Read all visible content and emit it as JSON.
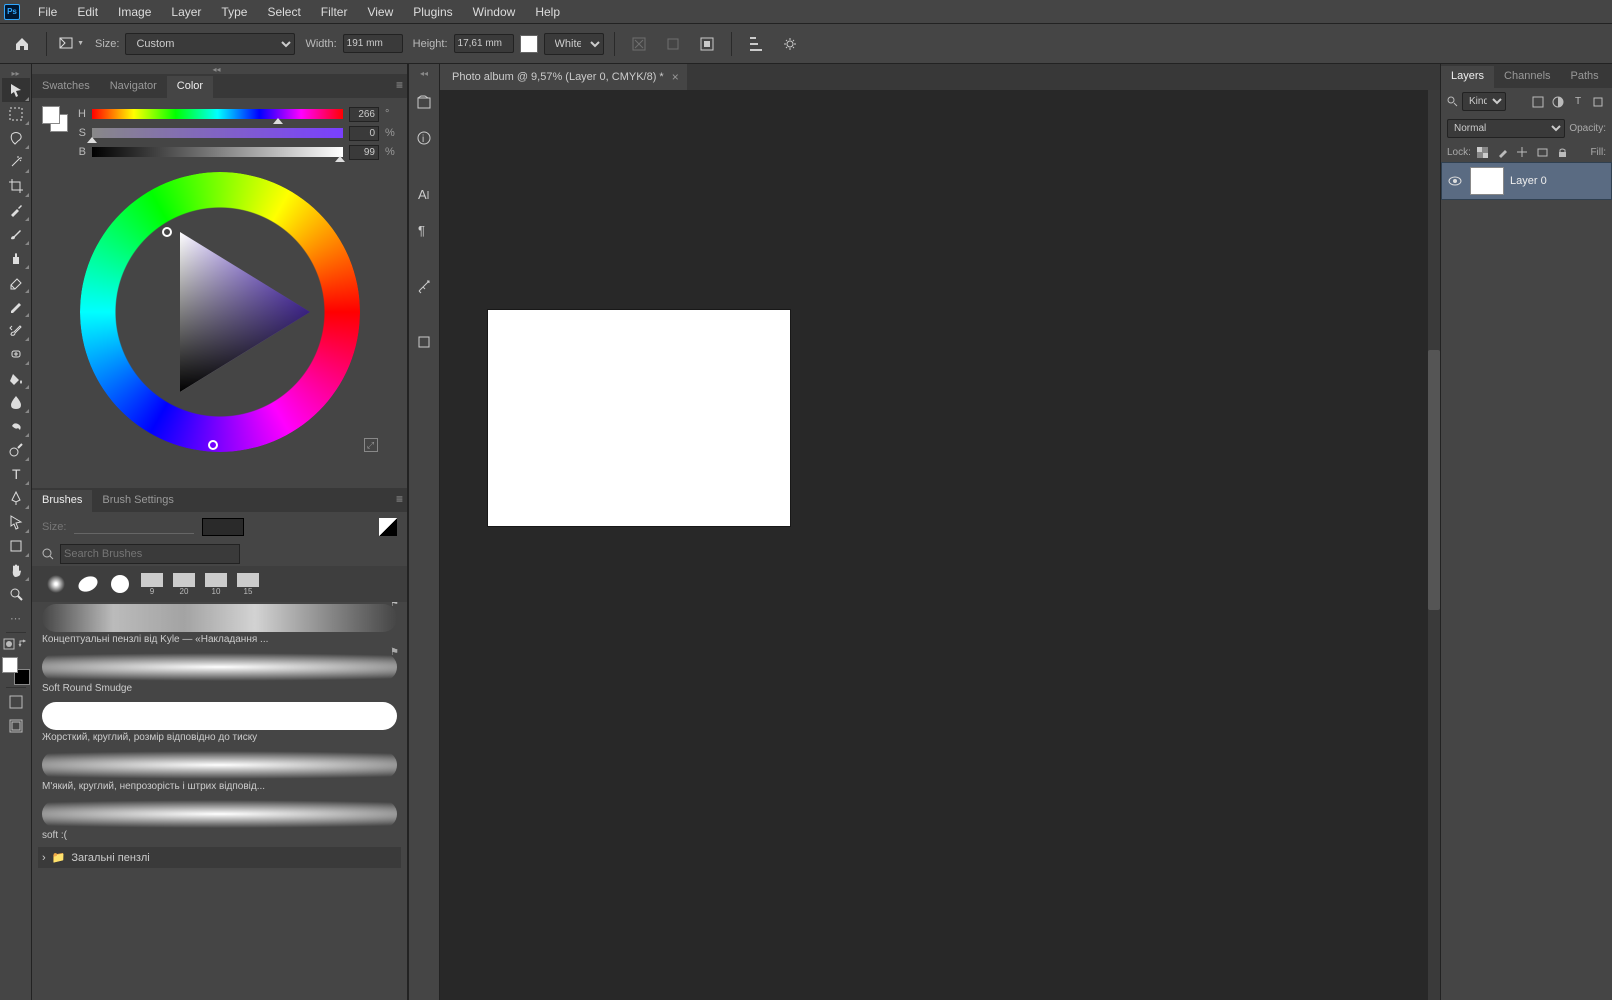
{
  "app": {
    "name": "Ps"
  },
  "menu": [
    "File",
    "Edit",
    "Image",
    "Layer",
    "Type",
    "Select",
    "Filter",
    "View",
    "Plugins",
    "Window",
    "Help"
  ],
  "options": {
    "size_label": "Size:",
    "size_preset": "Custom",
    "width_label": "Width:",
    "width_value": "191 mm",
    "height_label": "Height:",
    "height_value": "17,61 mm",
    "bg_label": "White"
  },
  "leftPanels": {
    "colorTabs": [
      "Swatches",
      "Navigator",
      "Color"
    ],
    "hsb": {
      "h_label": "H",
      "h_value": "266",
      "h_unit": "°",
      "s_label": "S",
      "s_value": "0",
      "s_unit": "%",
      "b_label": "B",
      "b_value": "99",
      "b_unit": "%"
    },
    "brushTabs": [
      "Brushes",
      "Brush Settings"
    ],
    "brush_size_label": "Size:",
    "search_placeholder": "Search Brushes",
    "thumbVals": [
      "9",
      "20",
      "10",
      "15"
    ],
    "brushes": [
      "Концептуальні пензлі від Kyle — «Накладання ...",
      "Soft Round Smudge",
      "Жорсткий, круглий, розмір відповідно до тиску",
      "М'який, круглий, непрозорість і штрих відповід...",
      "soft :("
    ],
    "folder": "Загальні пензлі"
  },
  "document": {
    "tab": "Photo album @ 9,57% (Layer 0, CMYK/8) *"
  },
  "layers": {
    "tabs": [
      "Layers",
      "Channels",
      "Paths"
    ],
    "kind": "Kind",
    "blend": "Normal",
    "opacity_label": "Opacity:",
    "lock_label": "Lock:",
    "fill_label": "Fill:",
    "layer0": "Layer 0"
  }
}
